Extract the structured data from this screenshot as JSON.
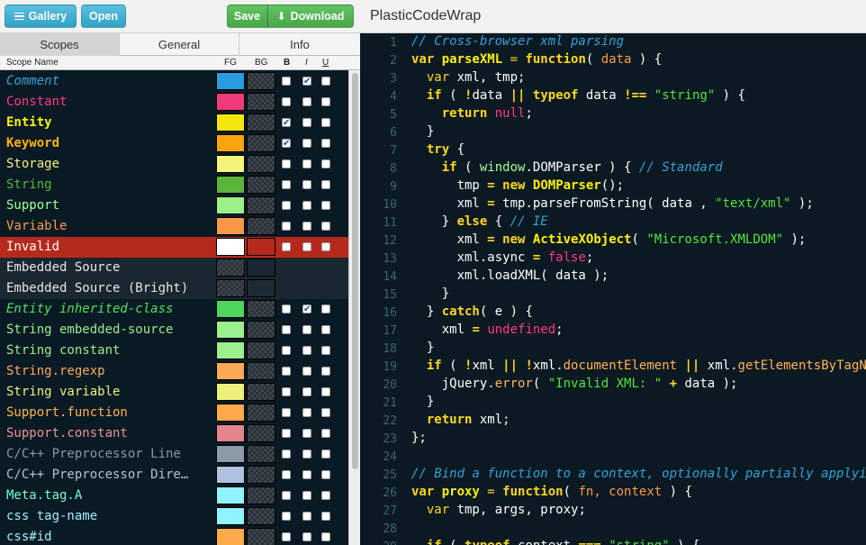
{
  "toolbar": {
    "gallery_label": "Gallery",
    "open_label": "Open",
    "save_label": "Save",
    "download_label": "Download",
    "theme_title": "PlasticCodeWrap"
  },
  "tabs": [
    "Scopes",
    "General",
    "Info"
  ],
  "columns": {
    "name": "Scope Name",
    "fg": "FG",
    "bg": "BG",
    "bold": "B",
    "italic": "I",
    "underline": "U"
  },
  "scopes": [
    {
      "name": "Comment",
      "fg": "#2a9de0",
      "bg": "",
      "b": false,
      "i": true,
      "u": false,
      "color": "#34a2d9",
      "italic": true
    },
    {
      "name": "Constant",
      "fg": "#f03a7a",
      "bg": "",
      "b": false,
      "i": false,
      "u": false,
      "color": "#ff3a83"
    },
    {
      "name": "Entity",
      "fg": "#f2e60e",
      "bg": "",
      "b": true,
      "i": false,
      "u": false,
      "color": "#fff00c",
      "bold": true
    },
    {
      "name": "Keyword",
      "fg": "#fca30e",
      "bg": "",
      "b": true,
      "i": false,
      "u": false,
      "color": "#ffb30e",
      "bold": true
    },
    {
      "name": "Storage",
      "fg": "#f4f47a",
      "bg": "",
      "b": false,
      "i": false,
      "u": false,
      "color": "#f6f080"
    },
    {
      "name": "String",
      "fg": "#59b63a",
      "bg": "",
      "b": false,
      "i": false,
      "u": false,
      "color": "#55b83a"
    },
    {
      "name": "Support",
      "fg": "#9bf08a",
      "bg": "",
      "b": false,
      "i": false,
      "u": false,
      "color": "#a2ff95"
    },
    {
      "name": "Variable",
      "fg": "#f9984a",
      "bg": "",
      "b": false,
      "i": false,
      "u": false,
      "color": "#fb9a4b"
    },
    {
      "name": "Invalid",
      "fg": "#ffffff",
      "bg": "#b52a1d",
      "b": false,
      "i": false,
      "u": false,
      "color": "#ffffff",
      "selected": true
    },
    {
      "name": "Embedded Source",
      "fg": "",
      "bg": "#1a2630",
      "b": null,
      "i": null,
      "u": null,
      "color": "#e8e8e8",
      "dark": true
    },
    {
      "name": "Embedded Source (Bright)",
      "fg": "",
      "bg": "#1d2a34",
      "b": null,
      "i": null,
      "u": null,
      "color": "#e8e8e8",
      "dark": true
    },
    {
      "name": "Entity inherited-class",
      "fg": "#4ed65a",
      "bg": "",
      "b": false,
      "i": true,
      "u": false,
      "color": "#53e05e",
      "italic": true
    },
    {
      "name": "String embedded-source",
      "fg": "#9bef8c",
      "bg": "",
      "b": false,
      "i": false,
      "u": false,
      "color": "#9bef8c"
    },
    {
      "name": "String constant",
      "fg": "#9bef8c",
      "bg": "",
      "b": false,
      "i": false,
      "u": false,
      "color": "#9bef8c"
    },
    {
      "name": "String.regexp",
      "fg": "#fca95a",
      "bg": "",
      "b": false,
      "i": false,
      "u": false,
      "color": "#fca95a"
    },
    {
      "name": "String variable",
      "fg": "#eaf07a",
      "bg": "",
      "b": false,
      "i": false,
      "u": false,
      "color": "#eaf07a"
    },
    {
      "name": "Support.function",
      "fg": "#fcaa4a",
      "bg": "",
      "b": false,
      "i": false,
      "u": false,
      "color": "#ffb454"
    },
    {
      "name": "Support.constant",
      "fg": "#e2868c",
      "bg": "",
      "b": false,
      "i": false,
      "u": false,
      "color": "#eb939a"
    },
    {
      "name": "C/C++ Preprocessor Line",
      "fg": "#8a9aa6",
      "bg": "",
      "b": false,
      "i": false,
      "u": false,
      "color": "#8996a8"
    },
    {
      "name": "C/C++ Preprocessor Directive",
      "display": "C/C++ Preprocessor Dire…",
      "fg": "#aec2e0",
      "bg": "",
      "b": false,
      "i": false,
      "u": false,
      "color": "#afc4db"
    },
    {
      "name": "Meta.tag.A",
      "fg": "#8ff4ff",
      "bg": "",
      "b": false,
      "i": false,
      "u": false,
      "color": "#73fcd2"
    },
    {
      "name": "css tag-name",
      "fg": "#8ff4ff",
      "bg": "",
      "b": false,
      "i": false,
      "u": false,
      "color": "#9ef0ff"
    },
    {
      "name": "css#id",
      "fg": "#fcaa4a",
      "bg": "",
      "b": false,
      "i": false,
      "u": false,
      "color": "#9ef0ff"
    }
  ],
  "code": {
    "lines": [
      [
        {
          "t": "// Cross-browser xml parsing",
          "c": "cm"
        }
      ],
      [
        {
          "t": "var ",
          "c": "kw"
        },
        {
          "t": "parseXML",
          "c": "en"
        },
        {
          "t": " = ",
          "c": "kw2"
        },
        {
          "t": "function",
          "c": "kw"
        },
        {
          "t": "( "
        },
        {
          "t": "data",
          "c": "va"
        },
        {
          "t": " ) {"
        }
      ],
      [
        {
          "t": "  var ",
          "c": "kw2"
        },
        {
          "t": "xml, tmp;"
        }
      ],
      [
        {
          "t": "  if",
          "c": "kw"
        },
        {
          "t": " ( "
        },
        {
          "t": "!",
          "c": "kw"
        },
        {
          "t": "data "
        },
        {
          "t": "||",
          "c": "kw"
        },
        {
          "t": " "
        },
        {
          "t": "typeof",
          "c": "kw"
        },
        {
          "t": " data "
        },
        {
          "t": "!==",
          "c": "kw"
        },
        {
          "t": " "
        },
        {
          "t": "\"string\"",
          "c": "st"
        },
        {
          "t": " ) {"
        }
      ],
      [
        {
          "t": "    return ",
          "c": "kw"
        },
        {
          "t": "null",
          "c": "ct"
        },
        {
          "t": ";"
        }
      ],
      [
        {
          "t": "  }"
        }
      ],
      [
        {
          "t": "  try",
          "c": "kw"
        },
        {
          "t": " {"
        }
      ],
      [
        {
          "t": "    if",
          "c": "kw"
        },
        {
          "t": " ( "
        },
        {
          "t": "window",
          "c": "su"
        },
        {
          "t": "."
        },
        {
          "t": "DOMParser"
        },
        {
          "t": " ) { "
        },
        {
          "t": "// Standard",
          "c": "cm"
        }
      ],
      [
        {
          "t": "      tmp "
        },
        {
          "t": "=",
          "c": "kw"
        },
        {
          "t": " "
        },
        {
          "t": "new",
          "c": "kw"
        },
        {
          "t": " "
        },
        {
          "t": "DOMParser",
          "c": "en"
        },
        {
          "t": "();"
        }
      ],
      [
        {
          "t": "      xml "
        },
        {
          "t": "=",
          "c": "kw"
        },
        {
          "t": " tmp.parseFromString( data , "
        },
        {
          "t": "\"text/xml\"",
          "c": "st"
        },
        {
          "t": " );"
        }
      ],
      [
        {
          "t": "    } "
        },
        {
          "t": "else",
          "c": "kw"
        },
        {
          "t": " { "
        },
        {
          "t": "// IE",
          "c": "cm"
        }
      ],
      [
        {
          "t": "      xml "
        },
        {
          "t": "=",
          "c": "kw"
        },
        {
          "t": " "
        },
        {
          "t": "new",
          "c": "kw"
        },
        {
          "t": " "
        },
        {
          "t": "ActiveXObject",
          "c": "en"
        },
        {
          "t": "( "
        },
        {
          "t": "\"Microsoft.XMLDOM\"",
          "c": "st"
        },
        {
          "t": " );"
        }
      ],
      [
        {
          "t": "      xml.async "
        },
        {
          "t": "=",
          "c": "kw"
        },
        {
          "t": " "
        },
        {
          "t": "false",
          "c": "ct"
        },
        {
          "t": ";"
        }
      ],
      [
        {
          "t": "      xml.loadXML( data );"
        }
      ],
      [
        {
          "t": "    }"
        }
      ],
      [
        {
          "t": "  } "
        },
        {
          "t": "catch",
          "c": "kw"
        },
        {
          "t": "( e ) {"
        }
      ],
      [
        {
          "t": "    xml "
        },
        {
          "t": "=",
          "c": "kw"
        },
        {
          "t": " "
        },
        {
          "t": "undefined",
          "c": "ct"
        },
        {
          "t": ";"
        }
      ],
      [
        {
          "t": "  }"
        }
      ],
      [
        {
          "t": "  if",
          "c": "kw"
        },
        {
          "t": " ( "
        },
        {
          "t": "!",
          "c": "kw"
        },
        {
          "t": "xml "
        },
        {
          "t": "||",
          "c": "kw"
        },
        {
          "t": " "
        },
        {
          "t": "!",
          "c": "kw"
        },
        {
          "t": "xml."
        },
        {
          "t": "documentElement",
          "c": "sf"
        },
        {
          "t": " "
        },
        {
          "t": "||",
          "c": "kw"
        },
        {
          "t": " xml."
        },
        {
          "t": "getElementsByTagName",
          "c": "sf"
        }
      ],
      [
        {
          "t": "    jQuery."
        },
        {
          "t": "error",
          "c": "sf"
        },
        {
          "t": "( "
        },
        {
          "t": "\"Invalid XML: \"",
          "c": "st"
        },
        {
          "t": " "
        },
        {
          "t": "+",
          "c": "kw"
        },
        {
          "t": " data );"
        }
      ],
      [
        {
          "t": "  }"
        }
      ],
      [
        {
          "t": "  return ",
          "c": "kw"
        },
        {
          "t": "xml;"
        }
      ],
      [
        {
          "t": "};"
        }
      ],
      [
        {
          "t": ""
        }
      ],
      [
        {
          "t": "// Bind a function to a context, optionally partially applying",
          "c": "cm"
        }
      ],
      [
        {
          "t": "var ",
          "c": "kw"
        },
        {
          "t": "proxy",
          "c": "en"
        },
        {
          "t": " = ",
          "c": "kw2"
        },
        {
          "t": "function",
          "c": "kw"
        },
        {
          "t": "( "
        },
        {
          "t": "fn, context",
          "c": "va"
        },
        {
          "t": " ) {"
        }
      ],
      [
        {
          "t": "  var ",
          "c": "kw2"
        },
        {
          "t": "tmp, args, proxy;"
        }
      ],
      [
        {
          "t": ""
        }
      ],
      [
        {
          "t": "  if",
          "c": "kw"
        },
        {
          "t": " ( "
        },
        {
          "t": "typeof",
          "c": "kw"
        },
        {
          "t": " context "
        },
        {
          "t": "===",
          "c": "kw"
        },
        {
          "t": " "
        },
        {
          "t": "\"string\"",
          "c": "st"
        },
        {
          "t": " ) {"
        }
      ]
    ]
  }
}
